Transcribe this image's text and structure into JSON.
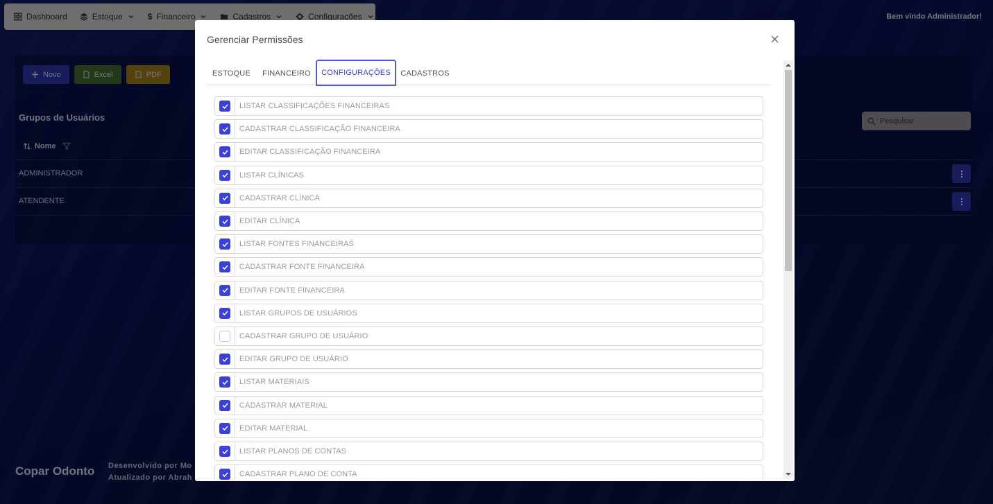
{
  "nav": {
    "items": [
      {
        "label": "Dashboard",
        "icon": "grid-icon"
      },
      {
        "label": "Estoque",
        "icon": "layers-icon"
      },
      {
        "label": "Financeiro",
        "icon": "dollar-icon"
      },
      {
        "label": "Cadastros",
        "icon": "folder-icon"
      },
      {
        "label": "Configurações",
        "icon": "gear-icon"
      }
    ],
    "welcome": "Bem vindo Administrador!"
  },
  "toolbar": {
    "novo": "Novo",
    "excel": "Excel",
    "pdf": "PDF"
  },
  "page": {
    "title": "Grupos de Usuários",
    "search_placeholder": "Pesquisar",
    "column_nome": "Nome",
    "rows": [
      "ADMINISTRADOR",
      "ATENDENTE"
    ]
  },
  "footer": {
    "brand": "Copar Odonto",
    "line1": "Desenvolvido por Mo",
    "line2": "Atualizado por Abrah"
  },
  "modal": {
    "title": "Gerenciar Permissões",
    "tabs": [
      "ESTOQUE",
      "FINANCEIRO",
      "CONFIGURAÇÕES",
      "CADASTROS"
    ],
    "active_tab": "CONFIGURAÇÕES",
    "permissions": [
      {
        "label": "LISTAR CLASSIFICAÇÕES FINANCEIRAS",
        "checked": true
      },
      {
        "label": "CADASTRAR CLASSIFICAÇÃO FINANCEIRA",
        "checked": true
      },
      {
        "label": "EDITAR CLASSIFICAÇÃO FINANCEIRA",
        "checked": true
      },
      {
        "label": "LISTAR CLÍNICAS",
        "checked": true
      },
      {
        "label": "CADASTRAR CLÍNICA",
        "checked": true
      },
      {
        "label": "EDITAR CLÍNICA",
        "checked": true
      },
      {
        "label": "LISTAR FONTES FINANCEIRAS",
        "checked": true
      },
      {
        "label": "CADASTRAR FONTE FINANCEIRA",
        "checked": true
      },
      {
        "label": "EDITAR FONTE FINANCEIRA",
        "checked": true
      },
      {
        "label": "LISTAR GRUPOS DE USUÁRIOS",
        "checked": true
      },
      {
        "label": "CADASTRAR GRUPO DE USUÁRIO",
        "checked": false
      },
      {
        "label": "EDITAR GRUPO DE USUÁRIO",
        "checked": true
      },
      {
        "label": "LISTAR MATERIAIS",
        "checked": true
      },
      {
        "label": "CADASTRAR MATERIAL",
        "checked": true
      },
      {
        "label": "EDITAR MATERIAL",
        "checked": true
      },
      {
        "label": "LISTAR PLANOS DE CONTAS",
        "checked": true
      },
      {
        "label": "CADASTRAR PLANO DE CONTA",
        "checked": true
      }
    ]
  },
  "colors": {
    "accent": "#3b40d8",
    "novo_button": "#2f33a8",
    "excel_button": "#3f6a2a",
    "pdf_button": "#9a7a1a"
  }
}
